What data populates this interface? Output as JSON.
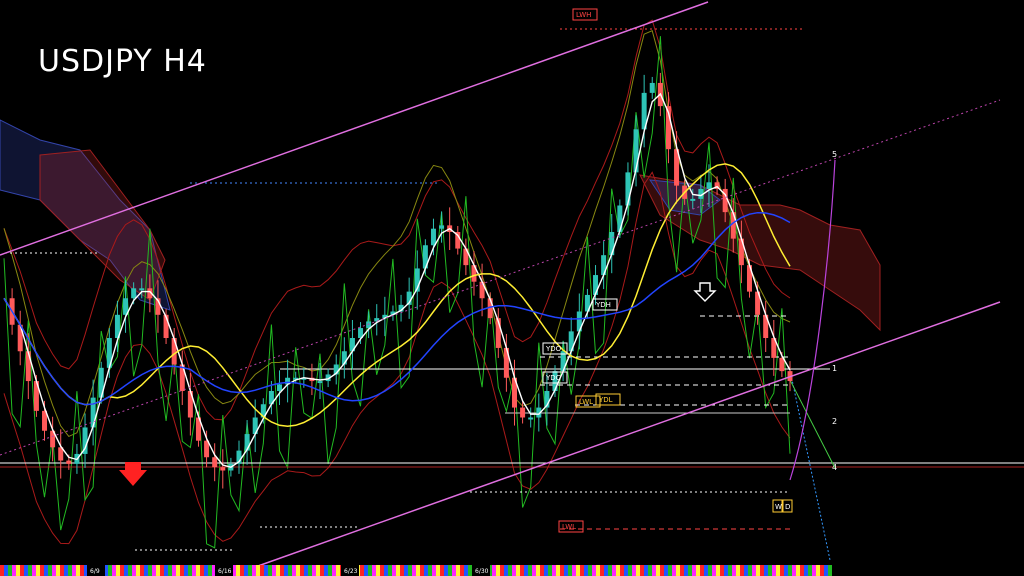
{
  "chart_data": {
    "type": "candlestick",
    "title": "USDJPY H4",
    "xlabel": "",
    "ylabel": "",
    "date_labels": [
      "6/9",
      "6/16",
      "6/23",
      "6/30"
    ],
    "box_labels": [
      "LWH",
      "YDH",
      "YDO",
      "YDC",
      "YDL",
      "LWL",
      "LWL"
    ],
    "level_labels": [
      "1",
      "2",
      "4",
      "5"
    ],
    "corner_labels": [
      "W",
      "D"
    ],
    "colors": {
      "bull": "#2ec4b6",
      "bear": "#ff5a5a",
      "channel": "#e06fe0",
      "ma_white": "#ffffff",
      "ma_yellow": "#ffee33",
      "ma_blue": "#2244ff",
      "osc_green": "#22bb22"
    },
    "close_series": [
      96.6,
      95.8,
      95.0,
      94.1,
      93.2,
      92.6,
      92.1,
      91.7,
      91.6,
      91.9,
      92.7,
      93.6,
      94.5,
      95.4,
      96.1,
      96.6,
      96.9,
      96.9,
      96.6,
      96.1,
      95.4,
      94.6,
      93.8,
      93.0,
      92.3,
      91.8,
      91.5,
      91.4,
      91.6,
      92.0,
      92.5,
      93.0,
      93.4,
      93.8,
      94.0,
      94.2,
      94.2,
      94.2,
      94.1,
      94.1,
      94.3,
      94.6,
      95.0,
      95.4,
      95.7,
      95.9,
      96.0,
      96.1,
      96.2,
      96.4,
      96.8,
      97.5,
      98.2,
      98.7,
      98.8,
      98.6,
      98.1,
      97.6,
      97.1,
      96.6,
      96.0,
      95.1,
      94.2,
      93.3,
      93.0,
      93.0,
      93.3,
      93.8,
      94.4,
      95.0,
      95.6,
      96.2,
      96.7,
      97.3,
      97.9,
      98.6,
      99.4,
      100.4,
      101.7,
      102.8,
      103.1,
      102.4,
      101.1,
      100.0,
      99.6,
      99.6,
      99.9,
      100.1,
      99.9,
      99.2,
      98.4,
      97.6,
      96.8,
      96.1,
      95.4,
      94.8,
      94.4,
      94.1
    ]
  }
}
